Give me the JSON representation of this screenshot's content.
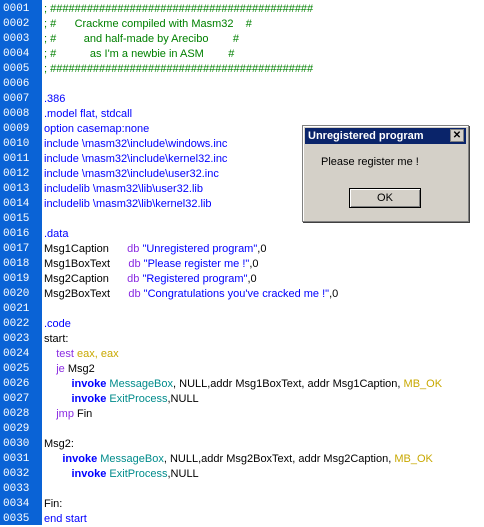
{
  "colors": {
    "gutter": "#0a63d6",
    "comment": "#008000",
    "directive": "#0000ff",
    "keyword": "#8a2be2",
    "string": "#0000ff",
    "constant": "#c8a800",
    "api": "#008b8b",
    "invoke": "#0000ff"
  },
  "editor": {
    "lines": [
      {
        "n": "0001",
        "tokens": [
          {
            "t": "; ###########################################",
            "k": "comment"
          }
        ]
      },
      {
        "n": "0002",
        "tokens": [
          {
            "t": "; #      Crackme compiled with Masm32    #",
            "k": "comment"
          }
        ]
      },
      {
        "n": "0003",
        "tokens": [
          {
            "t": "; #         and half-made by Arecibo        #",
            "k": "comment"
          }
        ]
      },
      {
        "n": "0004",
        "tokens": [
          {
            "t": "; #           as I'm a newbie in ASM        #",
            "k": "comment"
          }
        ]
      },
      {
        "n": "0005",
        "tokens": [
          {
            "t": "; ###########################################",
            "k": "comment"
          }
        ]
      },
      {
        "n": "0006",
        "tokens": []
      },
      {
        "n": "0007",
        "tokens": [
          {
            "t": ".386",
            "k": "directive"
          }
        ]
      },
      {
        "n": "0008",
        "tokens": [
          {
            "t": ".model flat, stdcall",
            "k": "directive"
          }
        ]
      },
      {
        "n": "0009",
        "tokens": [
          {
            "t": "option casemap:none",
            "k": "directive"
          }
        ]
      },
      {
        "n": "0010",
        "tokens": [
          {
            "t": "include \\masm32\\include\\windows.inc",
            "k": "directive"
          }
        ]
      },
      {
        "n": "0011",
        "tokens": [
          {
            "t": "include \\masm32\\include\\kernel32.inc",
            "k": "directive"
          }
        ]
      },
      {
        "n": "0012",
        "tokens": [
          {
            "t": "include \\masm32\\include\\user32.inc",
            "k": "directive"
          }
        ]
      },
      {
        "n": "0013",
        "tokens": [
          {
            "t": "includelib \\masm32\\lib\\user32.lib",
            "k": "directive"
          }
        ]
      },
      {
        "n": "0014",
        "tokens": [
          {
            "t": "includelib \\masm32\\lib\\kernel32.lib",
            "k": "directive"
          }
        ]
      },
      {
        "n": "0015",
        "tokens": []
      },
      {
        "n": "0016",
        "tokens": [
          {
            "t": ".data",
            "k": "directive"
          }
        ]
      },
      {
        "n": "0017",
        "tokens": [
          {
            "t": "Msg1Caption      ",
            "k": "black"
          },
          {
            "t": "db ",
            "k": "keyword"
          },
          {
            "t": "\"Unregistered program\"",
            "k": "string"
          },
          {
            "t": ",0",
            "k": "black"
          }
        ]
      },
      {
        "n": "0018",
        "tokens": [
          {
            "t": "Msg1BoxText      ",
            "k": "black"
          },
          {
            "t": "db ",
            "k": "keyword"
          },
          {
            "t": "\"Please register me !\"",
            "k": "string"
          },
          {
            "t": ",0",
            "k": "black"
          }
        ]
      },
      {
        "n": "0019",
        "tokens": [
          {
            "t": "Msg2Caption      ",
            "k": "black"
          },
          {
            "t": "db ",
            "k": "keyword"
          },
          {
            "t": "\"Registered program\"",
            "k": "string"
          },
          {
            "t": ",0",
            "k": "black"
          }
        ]
      },
      {
        "n": "0020",
        "tokens": [
          {
            "t": "Msg2BoxText      ",
            "k": "black"
          },
          {
            "t": "db ",
            "k": "keyword"
          },
          {
            "t": "\"Congratulations you've cracked me !\"",
            "k": "string"
          },
          {
            "t": ",0",
            "k": "black"
          }
        ]
      },
      {
        "n": "0021",
        "tokens": []
      },
      {
        "n": "0022",
        "tokens": [
          {
            "t": ".code",
            "k": "directive"
          }
        ]
      },
      {
        "n": "0023",
        "tokens": [
          {
            "t": "start:",
            "k": "black"
          }
        ]
      },
      {
        "n": "0024",
        "tokens": [
          {
            "t": "    test ",
            "k": "keyword"
          },
          {
            "t": "eax, eax",
            "k": "const"
          }
        ]
      },
      {
        "n": "0025",
        "tokens": [
          {
            "t": "    je ",
            "k": "keyword"
          },
          {
            "t": "Msg2",
            "k": "black"
          }
        ]
      },
      {
        "n": "0026",
        "tokens": [
          {
            "t": "         invoke ",
            "k": "invoke"
          },
          {
            "t": "MessageBox",
            "k": "api"
          },
          {
            "t": ", NULL,addr Msg1BoxText, addr Msg1Caption, ",
            "k": "black"
          },
          {
            "t": "MB_OK",
            "k": "const"
          }
        ]
      },
      {
        "n": "0027",
        "tokens": [
          {
            "t": "         invoke ",
            "k": "invoke"
          },
          {
            "t": "ExitProcess",
            "k": "api"
          },
          {
            "t": ",NULL",
            "k": "black"
          }
        ]
      },
      {
        "n": "0028",
        "tokens": [
          {
            "t": "    jmp ",
            "k": "keyword"
          },
          {
            "t": "Fin",
            "k": "black"
          }
        ]
      },
      {
        "n": "0029",
        "tokens": []
      },
      {
        "n": "0030",
        "tokens": [
          {
            "t": "Msg2:",
            "k": "black"
          }
        ]
      },
      {
        "n": "0031",
        "tokens": [
          {
            "t": "      invoke ",
            "k": "invoke"
          },
          {
            "t": "MessageBox",
            "k": "api"
          },
          {
            "t": ", NULL,addr Msg2BoxText, addr Msg2Caption, ",
            "k": "black"
          },
          {
            "t": "MB_OK",
            "k": "const"
          }
        ]
      },
      {
        "n": "0032",
        "tokens": [
          {
            "t": "         invoke ",
            "k": "invoke"
          },
          {
            "t": "ExitProcess",
            "k": "api"
          },
          {
            "t": ",NULL",
            "k": "black"
          }
        ]
      },
      {
        "n": "0033",
        "tokens": []
      },
      {
        "n": "0034",
        "tokens": [
          {
            "t": "Fin:",
            "k": "black"
          }
        ]
      },
      {
        "n": "0035",
        "tokens": [
          {
            "t": "end start",
            "k": "directive"
          }
        ]
      }
    ]
  },
  "dialog": {
    "title": "Unregistered program",
    "close_label": "✕",
    "message": "Please register me !",
    "ok_label": "OK"
  }
}
